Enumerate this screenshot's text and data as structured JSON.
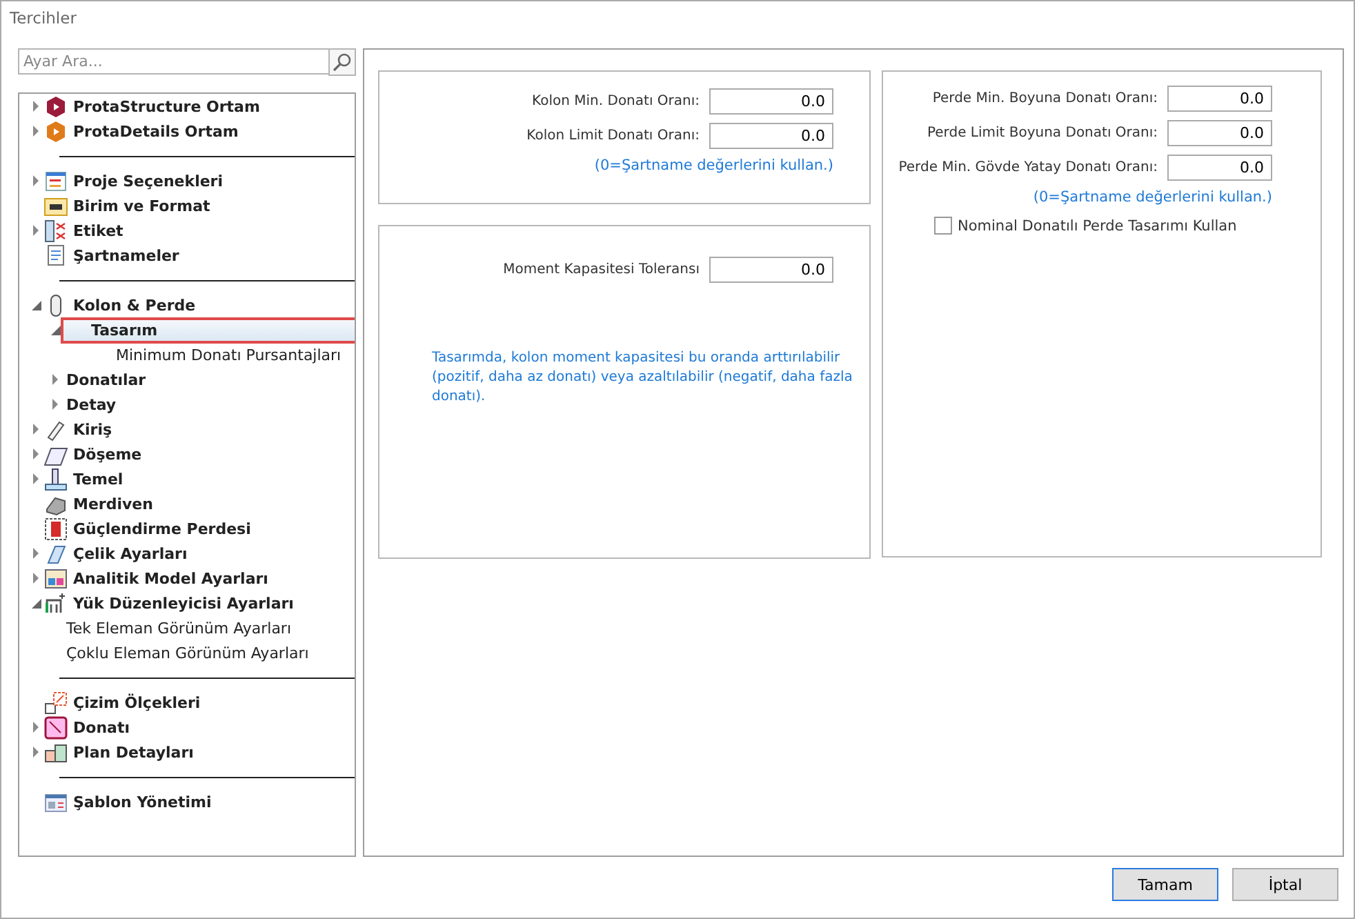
{
  "window": {
    "title": "Tercihler"
  },
  "search": {
    "placeholder": "Ayar Ara..."
  },
  "tree": [
    {
      "items": [
        {
          "label": "ProtaStructure Ortam",
          "expanded": false,
          "selected": false
        },
        {
          "label": "ProtaDetails Ortam",
          "expanded": false,
          "selected": false
        }
      ]
    },
    {
      "items": [
        {
          "label": "Proje Seçenekleri",
          "expanded": false,
          "selected": false
        },
        {
          "label": "Birim ve Format",
          "selected": false
        },
        {
          "label": "Etiket",
          "expanded": false,
          "selected": false
        },
        {
          "label": "Şartnameler",
          "selected": false
        }
      ]
    },
    {
      "items": [
        {
          "label": "Kolon & Perde",
          "expanded": true,
          "selected": false,
          "children": [
            {
              "label": "Tasarım",
              "expanded": true,
              "selected": true,
              "children": [
                {
                  "label": "Minimum Donatı Pursantajları",
                  "selected": false
                }
              ]
            },
            {
              "label": "Donatılar",
              "expanded": false,
              "selected": false
            },
            {
              "label": "Detay",
              "expanded": false,
              "selected": false
            }
          ]
        },
        {
          "label": "Kiriş",
          "expanded": false,
          "selected": false
        },
        {
          "label": "Döşeme",
          "expanded": false,
          "selected": false
        },
        {
          "label": "Temel",
          "expanded": false,
          "selected": false
        },
        {
          "label": "Merdiven",
          "selected": false
        },
        {
          "label": "Güçlendirme Perdesi",
          "selected": false
        },
        {
          "label": "Çelik Ayarları",
          "expanded": false,
          "selected": false
        },
        {
          "label": "Analitik Model Ayarları",
          "expanded": false,
          "selected": false
        },
        {
          "label": "Yük Düzenleyicisi Ayarları",
          "expanded": true,
          "selected": false,
          "children": [
            {
              "label": "Tek Eleman Görünüm Ayarları",
              "selected": false
            },
            {
              "label": "Çoklu Eleman Görünüm Ayarları",
              "selected": false
            }
          ]
        }
      ]
    },
    {
      "items": [
        {
          "label": "Çizim Ölçekleri",
          "selected": false
        },
        {
          "label": "Donatı",
          "expanded": false,
          "selected": false
        },
        {
          "label": "Plan Detayları",
          "expanded": false,
          "selected": false
        }
      ]
    },
    {
      "items": [
        {
          "label": "Şablon Yönetimi",
          "selected": false
        }
      ]
    }
  ],
  "panels": {
    "column_limits": {
      "fields": [
        {
          "label": "Kolon Min. Donatı Oranı:",
          "value": "0.0"
        },
        {
          "label": "Kolon Limit Donatı Oranı:",
          "value": "0.0"
        }
      ],
      "note": "(0=Şartname değerlerini kullan.)"
    },
    "moment": {
      "fields": [
        {
          "label": "Moment Kapasitesi Toleransı",
          "value": "0.0"
        }
      ],
      "note": "Tasarımda, kolon moment kapasitesi bu oranda arttırılabilir (pozitif, daha az donatı) veya azaltılabilir (negatif, daha fazla donatı)."
    },
    "wall_limits": {
      "fields": [
        {
          "label": "Perde Min. Boyuna Donatı Oranı:",
          "value": "0.0"
        },
        {
          "label": "Perde Limit Boyuna Donatı Oranı:",
          "value": "0.0"
        },
        {
          "label": "Perde Min. Gövde Yatay Donatı Oranı:",
          "value": "0.0"
        }
      ],
      "note": "(0=Şartname değerlerini kullan.)",
      "checkbox": {
        "label": "Nominal Donatılı Perde Tasarımı Kullan",
        "checked": false
      }
    }
  },
  "buttons": [
    {
      "label": "Tamam",
      "default": true
    },
    {
      "label": "İptal",
      "default": false
    }
  ]
}
